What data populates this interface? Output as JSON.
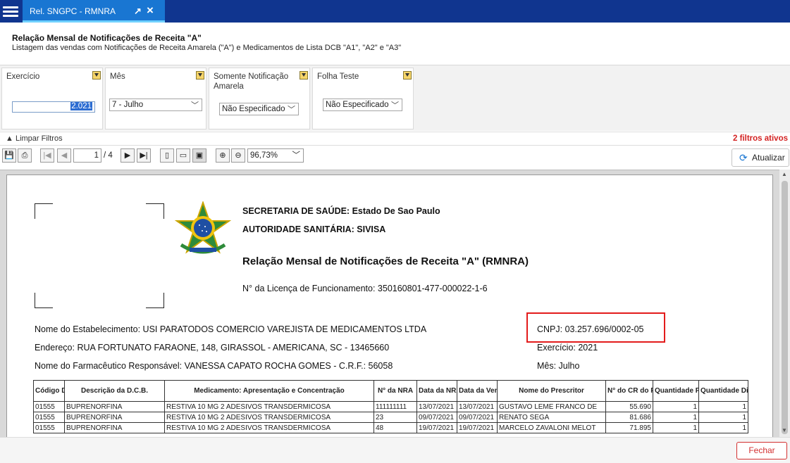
{
  "tab": {
    "title": "Rel. SNGPC - RMNRA"
  },
  "header": {
    "title": "Relação Mensal de Notificações de Receita \"A\"",
    "subtitle": "Listagem das vendas com Notificações de Receita Amarela (\"A\") e Medicamentos de Lista DCB \"A1\", \"A2\" e \"A3\""
  },
  "filters": {
    "exercicio": {
      "label": "Exercício",
      "value": "2.021"
    },
    "mes": {
      "label": "Mês",
      "value": "7 - Julho"
    },
    "notificacao": {
      "label": "Somente Notificação Amarela",
      "value": "Não Especificado"
    },
    "folha": {
      "label": "Folha Teste",
      "value": "Não Especificado"
    },
    "clear_label": "Limpar Filtros",
    "active_label": "2 filtros ativos"
  },
  "toolbar": {
    "page_value": "1",
    "page_total": "/ 4",
    "zoom": "96,73%",
    "refresh_label": "Atualizar"
  },
  "report": {
    "line1": "SECRETARIA DE SAÚDE: Estado De Sao Paulo",
    "line2": "AUTORIDADE SANITÁRIA: SIVISA",
    "title": "Relação Mensal de Notificações de Receita \"A\" (RMNRA)",
    "license": "N° da Licença de Funcionamento: 350160801-477-000022-1-6",
    "estab": "Nome do Estabelecimento: USI PARATODOS COMERCIO VAREJISTA DE MEDICAMENTOS LTDA",
    "cnpj": "CNPJ: 03.257.696/0002-05",
    "endereco": "Endereço: RUA FORTUNATO FARAONE, 148, GIRASSOL - AMERICANA, SC - 13465660",
    "exercicio": "Exercício: 2021",
    "farmaceutico": "Nome do Farmacêutico Responsável: VANESSA CAPATO ROCHA GOMES  -  C.R.F.: 56058",
    "mes": "Mês: Julho",
    "columns": [
      "Código DCB",
      "Descrição da D.C.B.",
      "Medicamento: Apresentação e Concentração",
      "N° da NRA",
      "Data da NRA",
      "Data da Venda",
      "Nome do Prescritor",
      "N° do CR do Prescritor",
      "Quantidade Prescrita",
      "Quantidade Dispensada"
    ],
    "rows": [
      [
        "01555",
        "BUPRENORFINA",
        "RESTIVA 10 MG 2 ADESIVOS TRANSDERMICOSA",
        "111111111",
        "13/07/2021",
        "13/07/2021",
        "GUSTAVO LEME FRANCO DE",
        "55.690",
        "1",
        "1"
      ],
      [
        "01555",
        "BUPRENORFINA",
        "RESTIVA 10 MG 2 ADESIVOS TRANSDERMICOSA",
        "23",
        "09/07/2021",
        "09/07/2021",
        "RENATO SEGA",
        "81.686",
        "1",
        "1"
      ],
      [
        "01555",
        "BUPRENORFINA",
        "RESTIVA 10 MG 2 ADESIVOS TRANSDERMICOSA",
        "48",
        "19/07/2021",
        "19/07/2021",
        "MARCELO ZAVALONI MELOT",
        "71.895",
        "1",
        "1"
      ]
    ]
  },
  "footer": {
    "close_label": "Fechar"
  }
}
